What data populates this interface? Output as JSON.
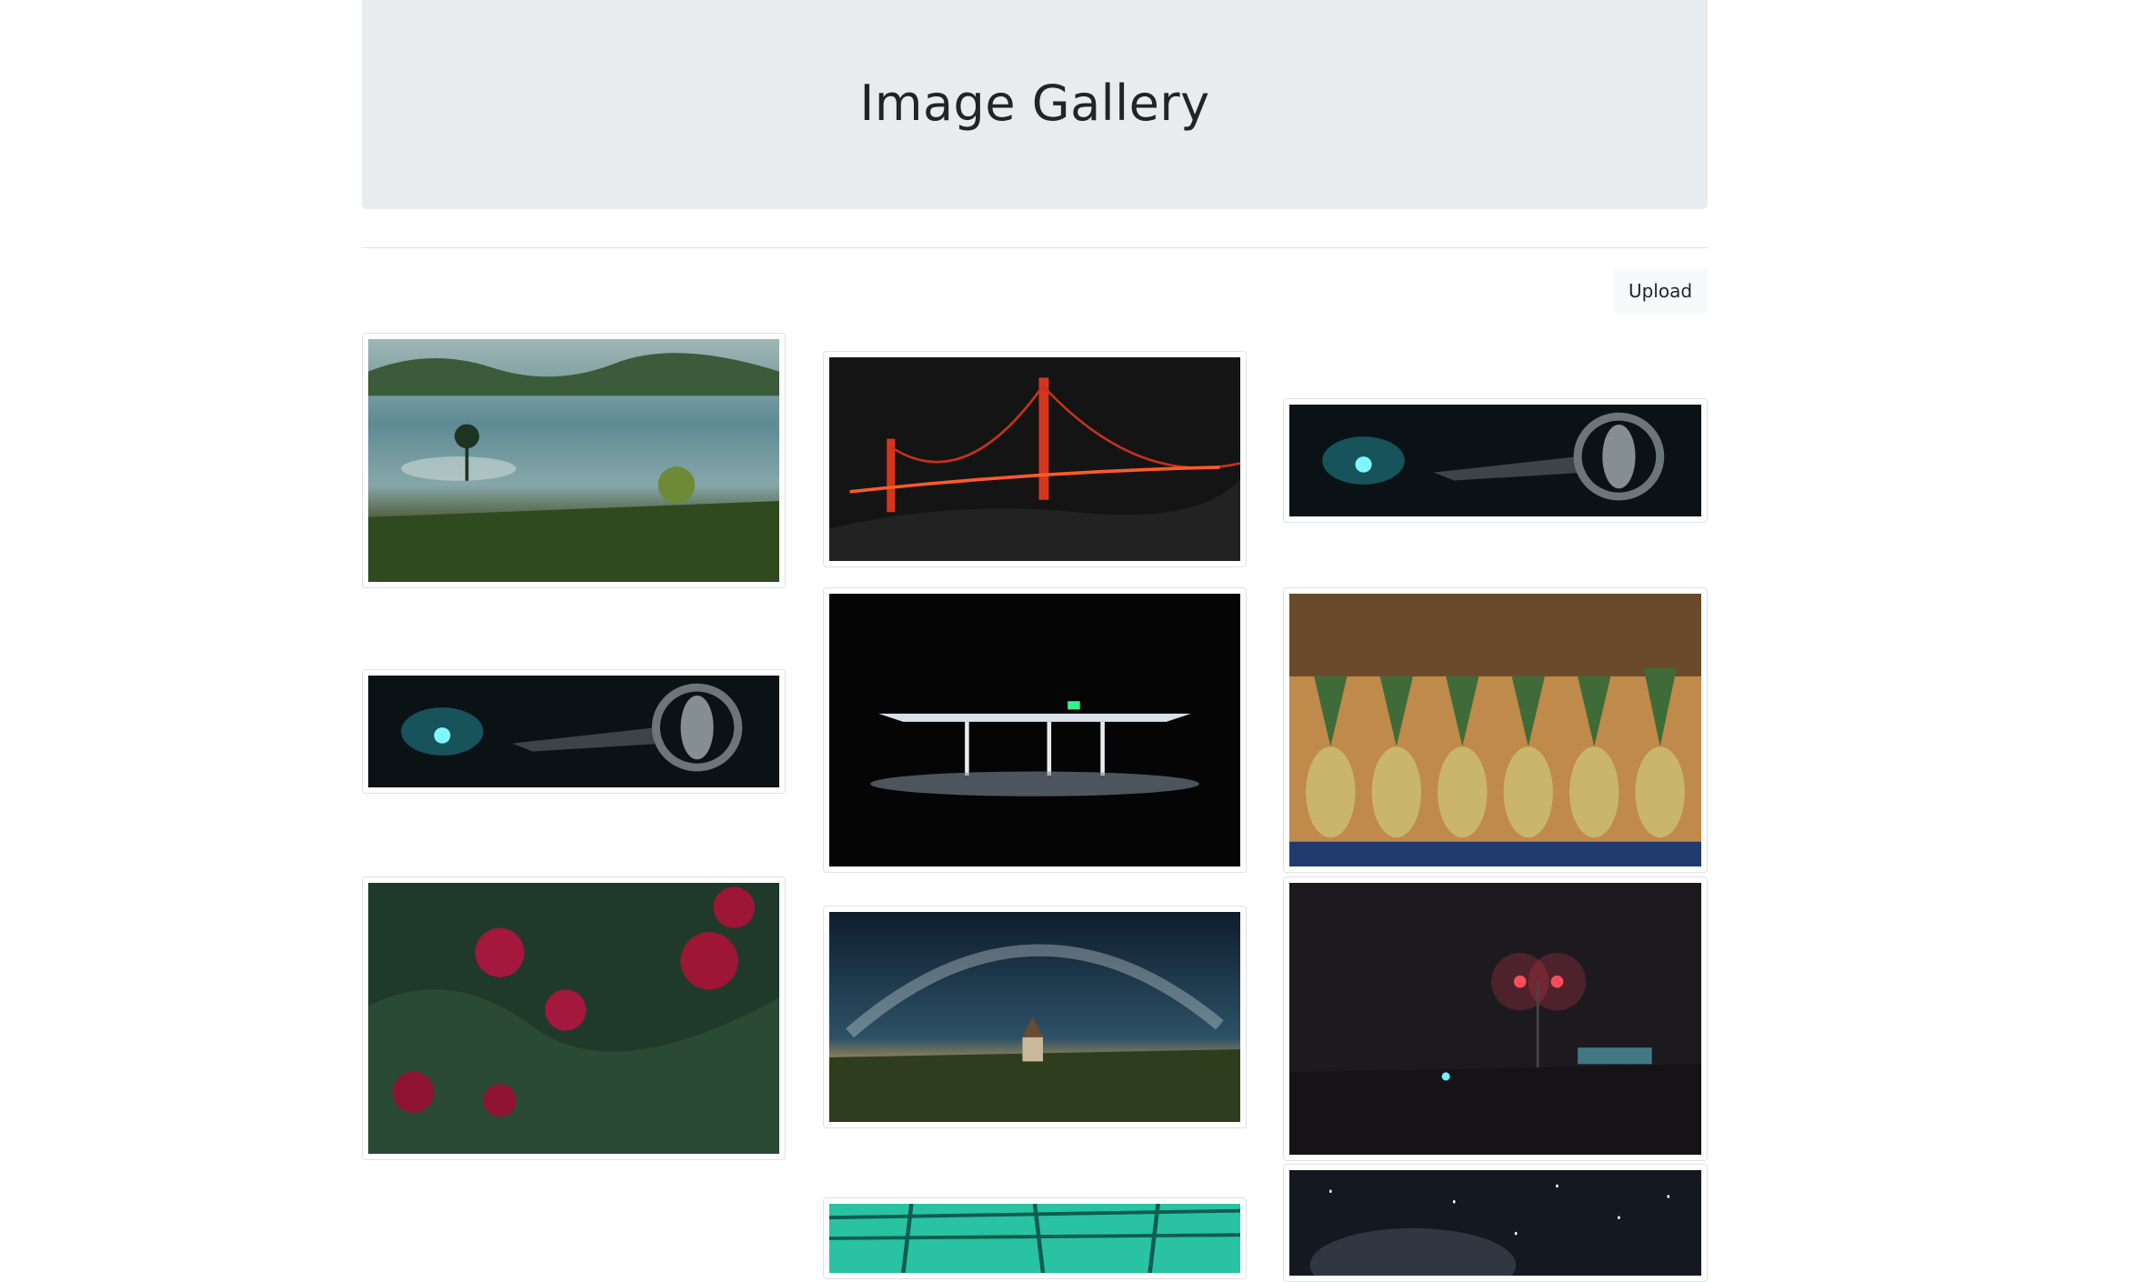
{
  "header": {
    "title": "Image Gallery"
  },
  "toolbar": {
    "upload_label": "Upload"
  },
  "gallery": {
    "images": [
      {
        "name": "misty-valley-photo",
        "subject": "misty green valley with trees at dawn"
      },
      {
        "name": "golden-gate-bridge-photo",
        "subject": "red suspension bridge at night"
      },
      {
        "name": "spaceship-scene-photo-1",
        "subject": "sci-fi spaceship in dark teal space"
      },
      {
        "name": "spaceship-scene-photo-2",
        "subject": "sci-fi spaceship in dark teal space"
      },
      {
        "name": "gas-station-photo",
        "subject": "lit gas station at night"
      },
      {
        "name": "pineapples-photo",
        "subject": "row of pineapples on a shelf"
      },
      {
        "name": "red-flowers-photo",
        "subject": "red peonies with dark green leaves"
      },
      {
        "name": "milky-way-church-photo",
        "subject": "milky way arch over a small church"
      },
      {
        "name": "foggy-street-night-photo",
        "subject": "red streetlights in foggy night"
      },
      {
        "name": "teal-glass-roof-photo",
        "subject": "teal glass ceiling structure"
      },
      {
        "name": "starry-sky-photo",
        "subject": "starry night sky"
      }
    ]
  }
}
